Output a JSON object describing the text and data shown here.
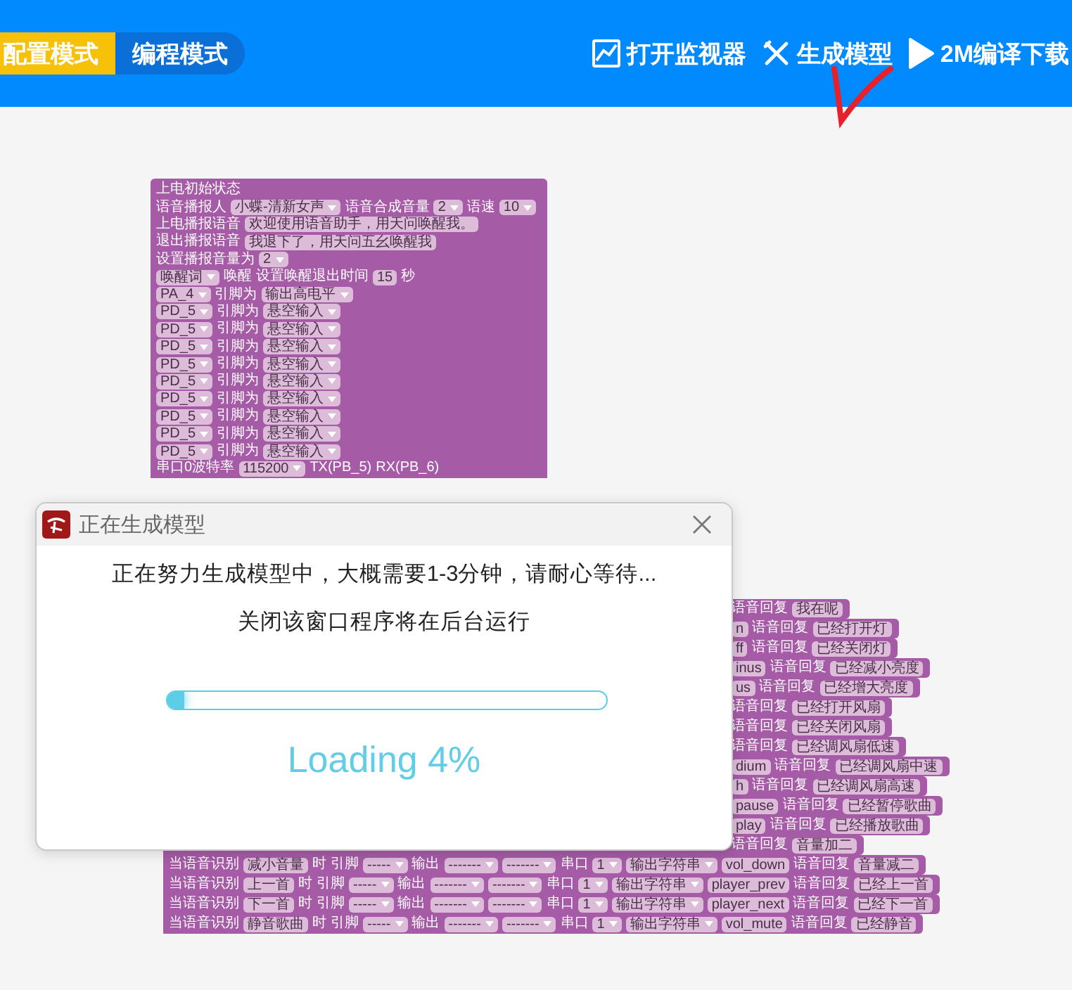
{
  "header": {
    "mode_tabs": [
      {
        "label": "配置模式",
        "selected": true
      },
      {
        "label": "编程模式",
        "selected": false
      }
    ],
    "actions": [
      {
        "kind": "monitor",
        "label": "打开监视器"
      },
      {
        "kind": "tools",
        "label": "生成模型"
      },
      {
        "kind": "play",
        "label": "2M编译下载"
      }
    ]
  },
  "init_block": {
    "rows": [
      [
        {
          "kind": "label",
          "text": "上电初始状态"
        }
      ],
      [
        {
          "kind": "label",
          "text": "语音播报人"
        },
        {
          "kind": "dropdown",
          "text": "小蝶-清新女声"
        },
        {
          "kind": "label",
          "text": "语音合成音量"
        },
        {
          "kind": "dropdown",
          "text": "2"
        },
        {
          "kind": "label",
          "text": "语速"
        },
        {
          "kind": "dropdown",
          "text": "10"
        }
      ],
      [
        {
          "kind": "label",
          "text": "上电播报语音"
        },
        {
          "kind": "input",
          "text": "欢迎使用语音助手，用天问唤醒我。"
        }
      ],
      [
        {
          "kind": "label",
          "text": "退出播报语音"
        },
        {
          "kind": "input",
          "text": "我退下了，用天问五幺唤醒我"
        }
      ],
      [
        {
          "kind": "label",
          "text": "设置播报音量为"
        },
        {
          "kind": "dropdown",
          "text": "2"
        }
      ],
      [
        {
          "kind": "dropdown",
          "text": "唤醒词"
        },
        {
          "kind": "label",
          "text": "唤醒"
        },
        {
          "kind": "label",
          "text": "设置唤醒退出时间"
        },
        {
          "kind": "input",
          "text": "15"
        },
        {
          "kind": "label",
          "text": "秒"
        }
      ],
      [
        {
          "kind": "dropdown",
          "text": "PA_4"
        },
        {
          "kind": "label",
          "text": "引脚为"
        },
        {
          "kind": "dropdown",
          "text": "输出高电平"
        }
      ],
      [
        {
          "kind": "dropdown",
          "text": "PD_5"
        },
        {
          "kind": "label",
          "text": "引脚为"
        },
        {
          "kind": "dropdown",
          "text": "悬空输入"
        }
      ],
      [
        {
          "kind": "dropdown",
          "text": "PD_5"
        },
        {
          "kind": "label",
          "text": "引脚为"
        },
        {
          "kind": "dropdown",
          "text": "悬空输入"
        }
      ],
      [
        {
          "kind": "dropdown",
          "text": "PD_5"
        },
        {
          "kind": "label",
          "text": "引脚为"
        },
        {
          "kind": "dropdown",
          "text": "悬空输入"
        }
      ],
      [
        {
          "kind": "dropdown",
          "text": "PD_5"
        },
        {
          "kind": "label",
          "text": "引脚为"
        },
        {
          "kind": "dropdown",
          "text": "悬空输入"
        }
      ],
      [
        {
          "kind": "dropdown",
          "text": "PD_5"
        },
        {
          "kind": "label",
          "text": "引脚为"
        },
        {
          "kind": "dropdown",
          "text": "悬空输入"
        }
      ],
      [
        {
          "kind": "dropdown",
          "text": "PD_5"
        },
        {
          "kind": "label",
          "text": "引脚为"
        },
        {
          "kind": "dropdown",
          "text": "悬空输入"
        }
      ],
      [
        {
          "kind": "dropdown",
          "text": "PD_5"
        },
        {
          "kind": "label",
          "text": "引脚为"
        },
        {
          "kind": "dropdown",
          "text": "悬空输入"
        }
      ],
      [
        {
          "kind": "dropdown",
          "text": "PD_5"
        },
        {
          "kind": "label",
          "text": "引脚为"
        },
        {
          "kind": "dropdown",
          "text": "悬空输入"
        }
      ],
      [
        {
          "kind": "dropdown",
          "text": "PD_5"
        },
        {
          "kind": "label",
          "text": "引脚为"
        },
        {
          "kind": "dropdown",
          "text": "悬空输入"
        }
      ],
      [
        {
          "kind": "label",
          "text": "串口0波特率"
        },
        {
          "kind": "dropdown",
          "text": "115200"
        },
        {
          "kind": "label",
          "text": "TX(PB_5)"
        },
        {
          "kind": "label",
          "text": "RX(PB_6)"
        }
      ]
    ]
  },
  "voice_block": {
    "rows": [
      {
        "covered": true,
        "parts": [
          {
            "kind": "label",
            "text": "语音回复"
          },
          {
            "kind": "input",
            "text": "我在呢"
          }
        ]
      },
      {
        "covered": true,
        "parts": [
          {
            "kind": "input",
            "text": "n"
          },
          {
            "kind": "label",
            "text": "语音回复"
          },
          {
            "kind": "input",
            "text": "已经打开灯"
          }
        ]
      },
      {
        "covered": true,
        "parts": [
          {
            "kind": "input",
            "text": "ff"
          },
          {
            "kind": "label",
            "text": "语音回复"
          },
          {
            "kind": "input",
            "text": "已经关闭灯"
          }
        ]
      },
      {
        "covered": true,
        "parts": [
          {
            "kind": "input",
            "text": "inus"
          },
          {
            "kind": "label",
            "text": "语音回复"
          },
          {
            "kind": "input",
            "text": "已经减小亮度"
          }
        ]
      },
      {
        "covered": true,
        "parts": [
          {
            "kind": "input",
            "text": "us"
          },
          {
            "kind": "label",
            "text": "语音回复"
          },
          {
            "kind": "input",
            "text": "已经增大亮度"
          }
        ]
      },
      {
        "covered": true,
        "parts": [
          {
            "kind": "label",
            "text": "语音回复"
          },
          {
            "kind": "input",
            "text": "已经打开风扇"
          }
        ]
      },
      {
        "covered": true,
        "parts": [
          {
            "kind": "label",
            "text": "语音回复"
          },
          {
            "kind": "input",
            "text": "已经关闭风扇"
          }
        ]
      },
      {
        "covered": true,
        "parts": [
          {
            "kind": "label",
            "text": "语音回复"
          },
          {
            "kind": "input",
            "text": "已经调风扇低速"
          }
        ]
      },
      {
        "covered": true,
        "parts": [
          {
            "kind": "input",
            "text": "dium"
          },
          {
            "kind": "label",
            "text": "语音回复"
          },
          {
            "kind": "input",
            "text": "已经调风扇中速"
          }
        ]
      },
      {
        "covered": true,
        "parts": [
          {
            "kind": "input",
            "text": "h"
          },
          {
            "kind": "label",
            "text": "语音回复"
          },
          {
            "kind": "input",
            "text": "已经调风扇高速"
          }
        ]
      },
      {
        "covered": true,
        "parts": [
          {
            "kind": "input",
            "text": "pause"
          },
          {
            "kind": "label",
            "text": "语音回复"
          },
          {
            "kind": "input",
            "text": "已经暂停歌曲"
          }
        ]
      },
      {
        "covered": true,
        "parts": [
          {
            "kind": "input",
            "text": "play"
          },
          {
            "kind": "label",
            "text": "语音回复"
          },
          {
            "kind": "input",
            "text": "已经播放歌曲"
          }
        ]
      },
      {
        "covered": true,
        "parts": [
          {
            "kind": "label",
            "text": "语音回复"
          },
          {
            "kind": "input",
            "text": "音量加二"
          }
        ]
      },
      {
        "covered": false,
        "parts": [
          {
            "kind": "label",
            "text": "当语音识别"
          },
          {
            "kind": "input",
            "text": "减小音量"
          },
          {
            "kind": "label",
            "text": "时"
          },
          {
            "kind": "label",
            "text": "引脚"
          },
          {
            "kind": "dropdown",
            "text": "-----"
          },
          {
            "kind": "label",
            "text": "输出"
          },
          {
            "kind": "dropdown",
            "text": "-------"
          },
          {
            "kind": "dropdown",
            "text": "-------"
          },
          {
            "kind": "label",
            "text": "串口"
          },
          {
            "kind": "dropdown",
            "text": "1"
          },
          {
            "kind": "dropdown",
            "text": "输出字符串"
          },
          {
            "kind": "input",
            "text": "vol_down"
          },
          {
            "kind": "label",
            "text": "语音回复"
          },
          {
            "kind": "input",
            "text": "音量减二"
          }
        ]
      },
      {
        "covered": false,
        "parts": [
          {
            "kind": "label",
            "text": "当语音识别"
          },
          {
            "kind": "input",
            "text": "上一首"
          },
          {
            "kind": "label",
            "text": "时"
          },
          {
            "kind": "label",
            "text": "引脚"
          },
          {
            "kind": "dropdown",
            "text": "-----"
          },
          {
            "kind": "label",
            "text": "输出"
          },
          {
            "kind": "dropdown",
            "text": "-------"
          },
          {
            "kind": "dropdown",
            "text": "-------"
          },
          {
            "kind": "label",
            "text": "串口"
          },
          {
            "kind": "dropdown",
            "text": "1"
          },
          {
            "kind": "dropdown",
            "text": "输出字符串"
          },
          {
            "kind": "input",
            "text": "player_prev"
          },
          {
            "kind": "label",
            "text": "语音回复"
          },
          {
            "kind": "input",
            "text": "已经上一首"
          }
        ]
      },
      {
        "covered": false,
        "parts": [
          {
            "kind": "label",
            "text": "当语音识别"
          },
          {
            "kind": "input",
            "text": "下一首"
          },
          {
            "kind": "label",
            "text": "时"
          },
          {
            "kind": "label",
            "text": "引脚"
          },
          {
            "kind": "dropdown",
            "text": "-----"
          },
          {
            "kind": "label",
            "text": "输出"
          },
          {
            "kind": "dropdown",
            "text": "-------"
          },
          {
            "kind": "dropdown",
            "text": "-------"
          },
          {
            "kind": "label",
            "text": "串口"
          },
          {
            "kind": "dropdown",
            "text": "1"
          },
          {
            "kind": "dropdown",
            "text": "输出字符串"
          },
          {
            "kind": "input",
            "text": "player_next"
          },
          {
            "kind": "label",
            "text": "语音回复"
          },
          {
            "kind": "input",
            "text": "已经下一首"
          }
        ]
      },
      {
        "covered": false,
        "parts": [
          {
            "kind": "label",
            "text": "当语音识别"
          },
          {
            "kind": "input",
            "text": "静音歌曲"
          },
          {
            "kind": "label",
            "text": "时"
          },
          {
            "kind": "label",
            "text": "引脚"
          },
          {
            "kind": "dropdown",
            "text": "-----"
          },
          {
            "kind": "label",
            "text": "输出"
          },
          {
            "kind": "dropdown",
            "text": "-------"
          },
          {
            "kind": "dropdown",
            "text": "-------"
          },
          {
            "kind": "label",
            "text": "串口"
          },
          {
            "kind": "dropdown",
            "text": "1"
          },
          {
            "kind": "dropdown",
            "text": "输出字符串"
          },
          {
            "kind": "input",
            "text": "vol_mute"
          },
          {
            "kind": "label",
            "text": "语音回复"
          },
          {
            "kind": "input",
            "text": "已经静音"
          }
        ]
      }
    ]
  },
  "dialog": {
    "title": "正在生成模型",
    "message": "正在努力生成模型中，大概需要1-3分钟，请耐心等待...",
    "note": "关闭该窗口程序将在后台运行",
    "progress": {
      "level": 0.04
    },
    "status": "Loading 4%"
  }
}
